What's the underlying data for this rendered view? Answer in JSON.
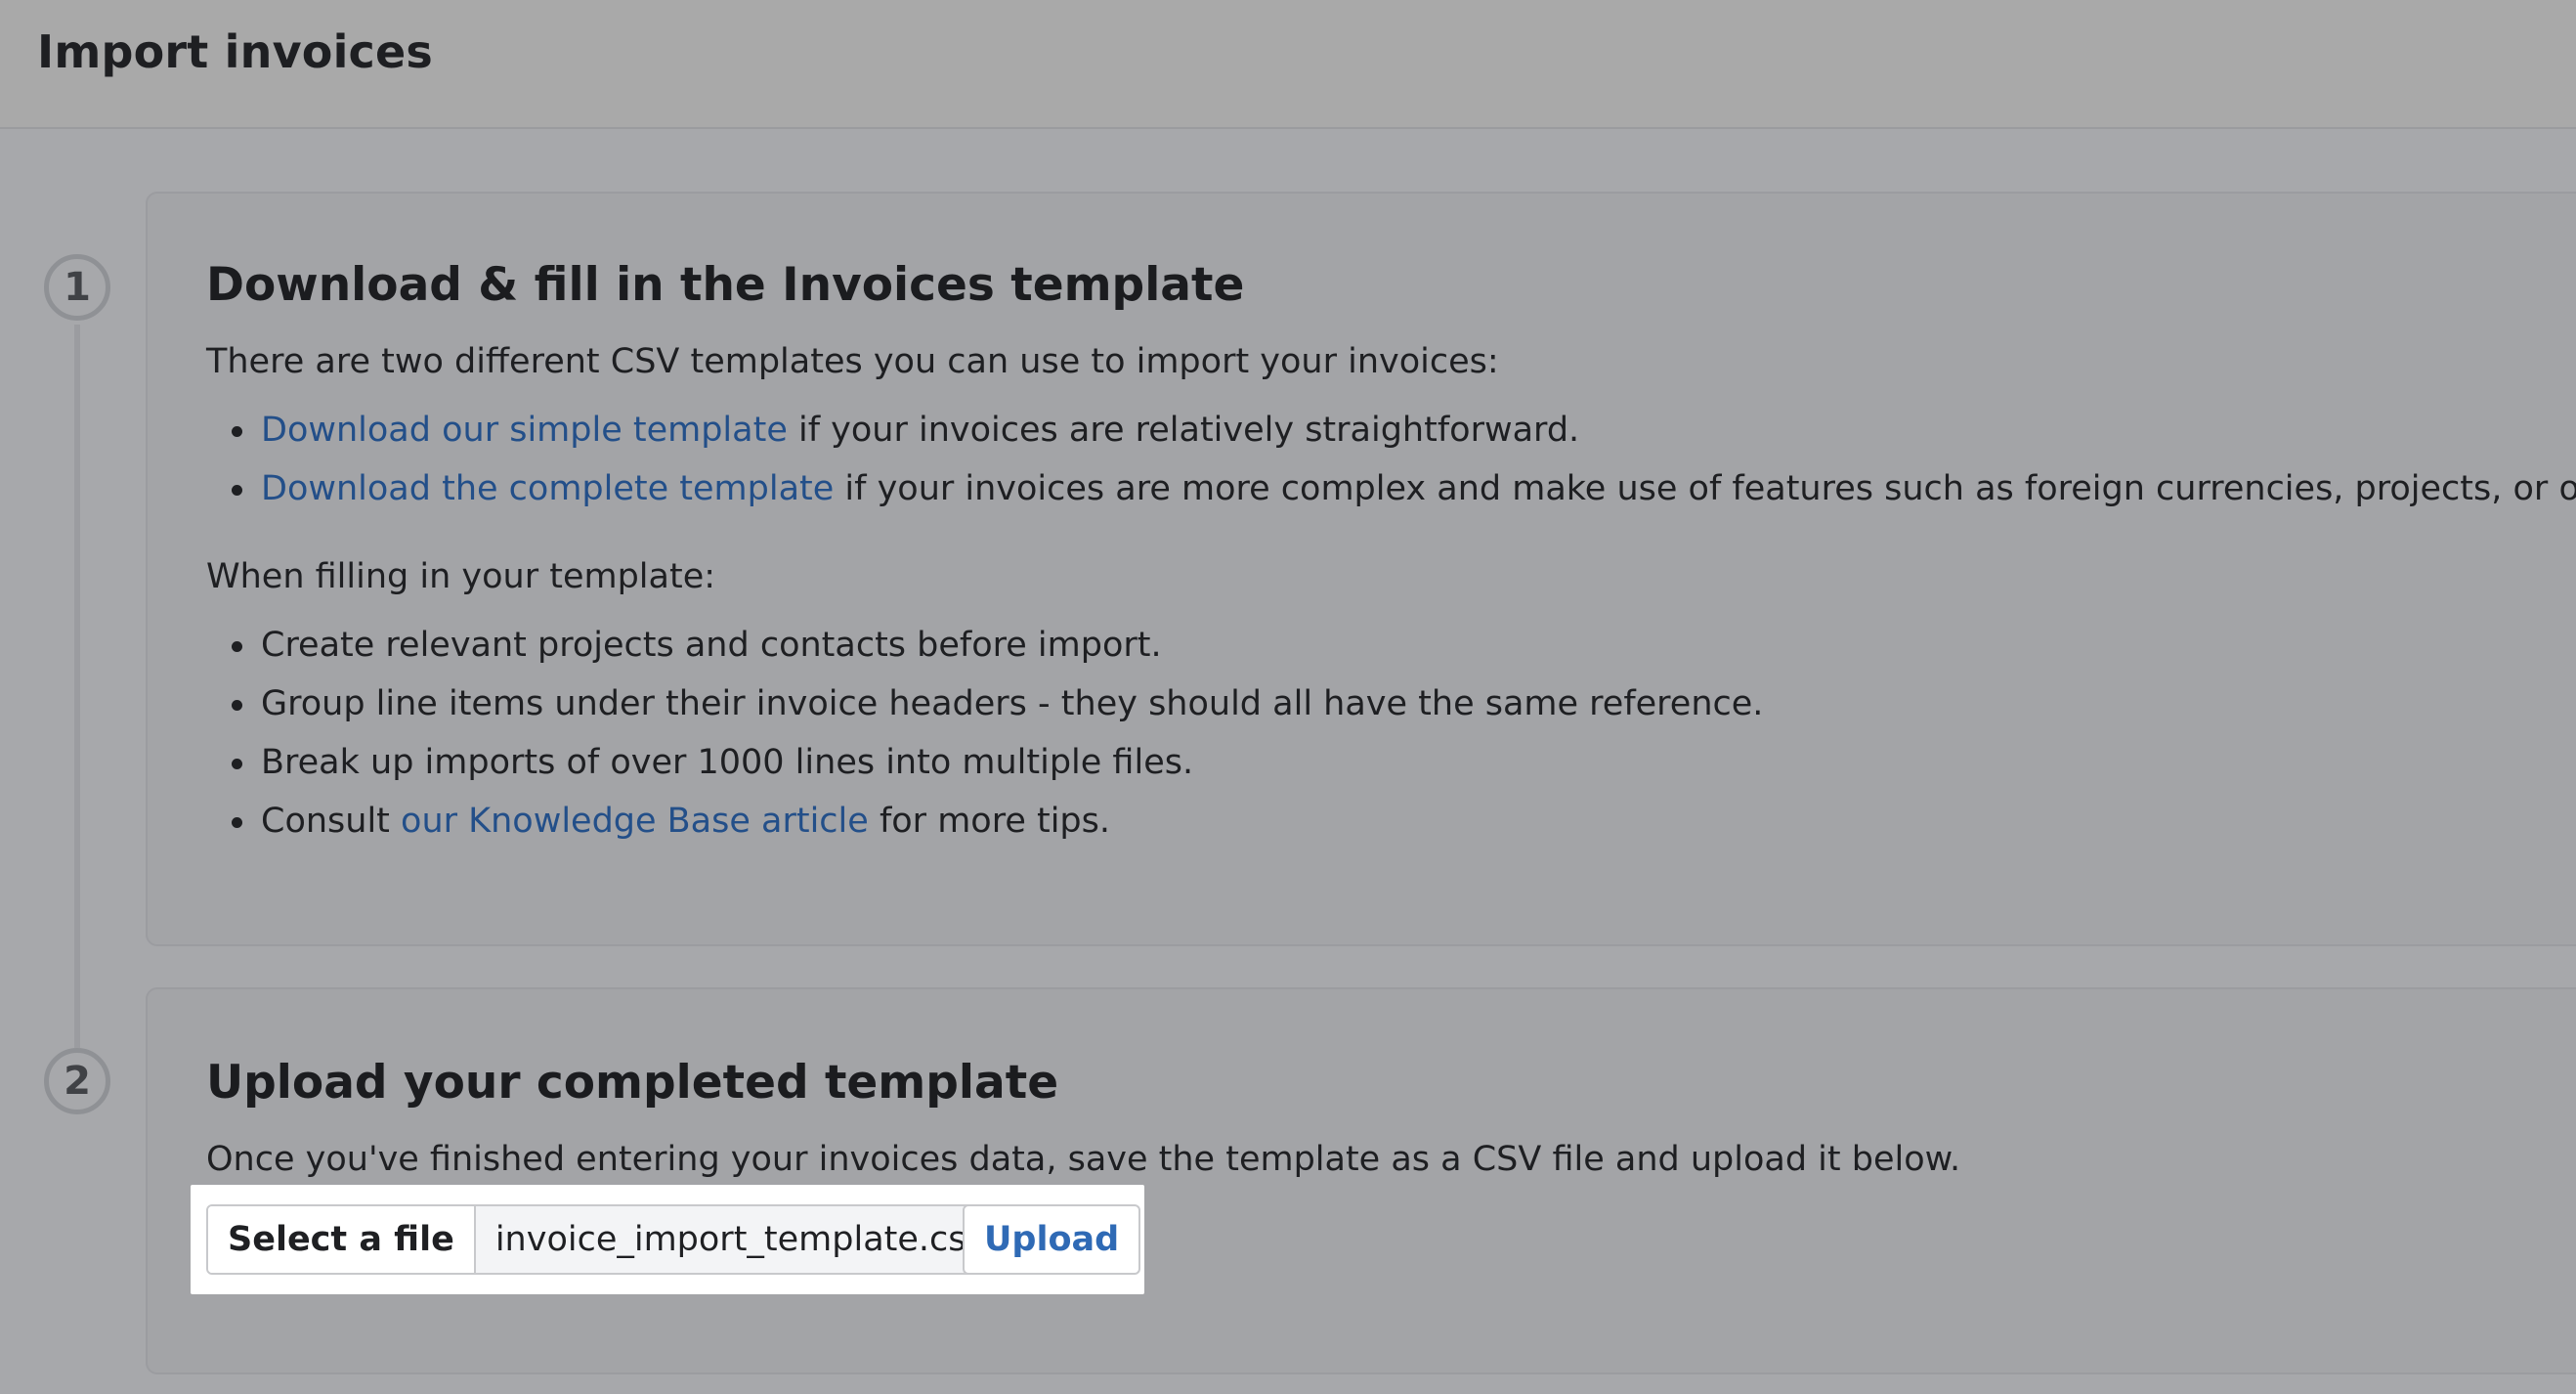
{
  "header": {
    "title": "Import invoices"
  },
  "steps": [
    {
      "number": "1"
    },
    {
      "number": "2"
    }
  ],
  "step1": {
    "heading": "Download & fill in the Invoices template",
    "intro": "There are two different CSV templates you can use to import your invoices:",
    "templates": [
      {
        "link": "Download our simple template",
        "rest": " if your invoices are relatively straightforward."
      },
      {
        "link": "Download the complete template",
        "rest": " if your invoices are more complex and make use of features such as foreign currencies, projects, or others."
      }
    ],
    "filling_intro": "When filling in your template:",
    "tips": [
      "Create relevant projects and contacts before import.",
      "Group line items under their invoice headers - they should all have the same reference.",
      "Break up imports of over 1000 lines into multiple files."
    ],
    "consult": {
      "prefix": "Consult ",
      "link": "our Knowledge Base article",
      "suffix": " for more tips."
    }
  },
  "step2": {
    "heading": "Upload your completed template",
    "description": "Once you've finished entering your invoices data, save the template as a CSV file and upload it below.",
    "select_file_label": "Select a file",
    "file_name": "invoice_import_template.csv",
    "upload_label": "Upload"
  },
  "colors": {
    "link": "#234f89",
    "upload_button_text": "#2f6ab5",
    "backdrop": "#a7a8ab"
  }
}
